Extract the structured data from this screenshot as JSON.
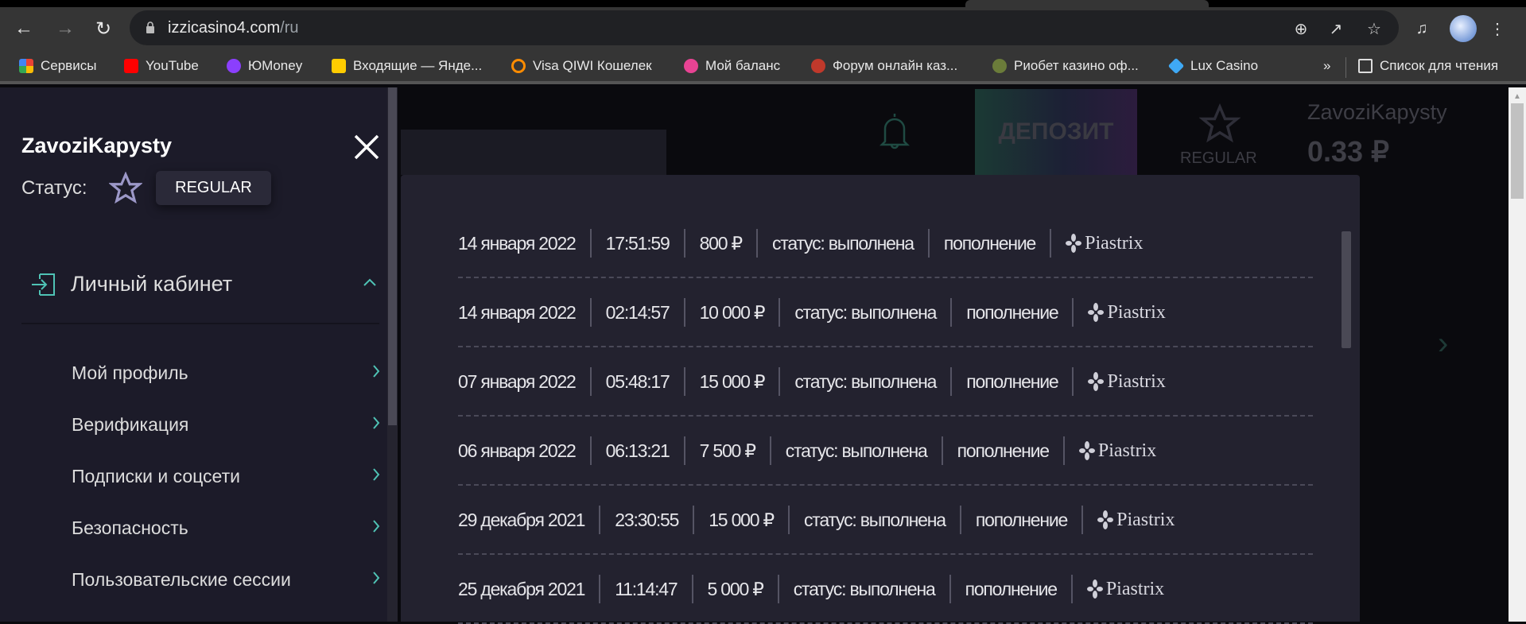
{
  "browser": {
    "url_host": "izzicasino4.com",
    "url_path": "/ru",
    "bookmarks": [
      {
        "label": "Сервисы",
        "color": "#ea4335"
      },
      {
        "label": "YouTube",
        "color": "#ff0000"
      },
      {
        "label": "ЮMoney",
        "color": "#8b3ffd"
      },
      {
        "label": "Входящие — Янде...",
        "color": "#ffcc00"
      },
      {
        "label": "Visa QIWI Кошелек",
        "color": "#ff8c00"
      },
      {
        "label": "Мой баланс",
        "color": "#e84393"
      },
      {
        "label": "Форум онлайн каз...",
        "color": "#c0392b"
      },
      {
        "label": "Риобет казино оф...",
        "color": "#6b7c3a"
      },
      {
        "label": "Lux Casino",
        "color": "#3fa9f5"
      }
    ],
    "more": "»",
    "reading_list": "Список для чтения"
  },
  "header": {
    "deposit": "ДЕПОЗИТ",
    "status": "REGULAR",
    "username": "ZavoziKapysty",
    "balance": "0.33 ₽"
  },
  "sidebar": {
    "username": "ZavoziKapysty",
    "status_label": "Статус:",
    "status_badge": "REGULAR",
    "section": "Личный кабинет",
    "items": [
      {
        "label": "Мой профиль"
      },
      {
        "label": "Верификация"
      },
      {
        "label": "Подписки и соцсети"
      },
      {
        "label": "Безопасность"
      },
      {
        "label": "Пользовательские сессии"
      }
    ]
  },
  "transactions": [
    {
      "date": "14 января 2022",
      "time": "17:51:59",
      "amount": "800 ₽",
      "status": "статус: выполнена",
      "type": "пополнение",
      "method": "Piastrix"
    },
    {
      "date": "14 января 2022",
      "time": "02:14:57",
      "amount": "10 000 ₽",
      "status": "статус: выполнена",
      "type": "пополнение",
      "method": "Piastrix"
    },
    {
      "date": "07 января 2022",
      "time": "05:48:17",
      "amount": "15 000 ₽",
      "status": "статус: выполнена",
      "type": "пополнение",
      "method": "Piastrix"
    },
    {
      "date": "06 января 2022",
      "time": "06:13:21",
      "amount": "7 500 ₽",
      "status": "статус: выполнена",
      "type": "пополнение",
      "method": "Piastrix"
    },
    {
      "date": "29 декабря 2021",
      "time": "23:30:55",
      "amount": "15 000 ₽",
      "status": "статус: выполнена",
      "type": "пополнение",
      "method": "Piastrix"
    },
    {
      "date": "25 декабря 2021",
      "time": "11:14:47",
      "amount": "5 000 ₽",
      "status": "статус: выполнена",
      "type": "пополнение",
      "method": "Piastrix"
    }
  ],
  "colors": {
    "accent": "#4fc3b5",
    "sidebar_bg": "#1c1b29",
    "modal_bg": "#23222f"
  }
}
